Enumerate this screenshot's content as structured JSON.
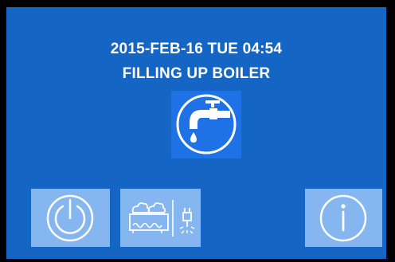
{
  "header": {
    "datetime": "2015-FEB-16 TUE 04:54",
    "status": "FILLING UP BOILER"
  },
  "icons": {
    "center": "water-tap-icon",
    "power": "power-icon",
    "mode": "heater-cleaning-power-icon",
    "info": "info-icon"
  },
  "colors": {
    "background": "#1565c4",
    "frame": "#000000",
    "button": "#85b6f0",
    "center_icon_bg": "#1f72e6",
    "text": "#ffffff"
  }
}
